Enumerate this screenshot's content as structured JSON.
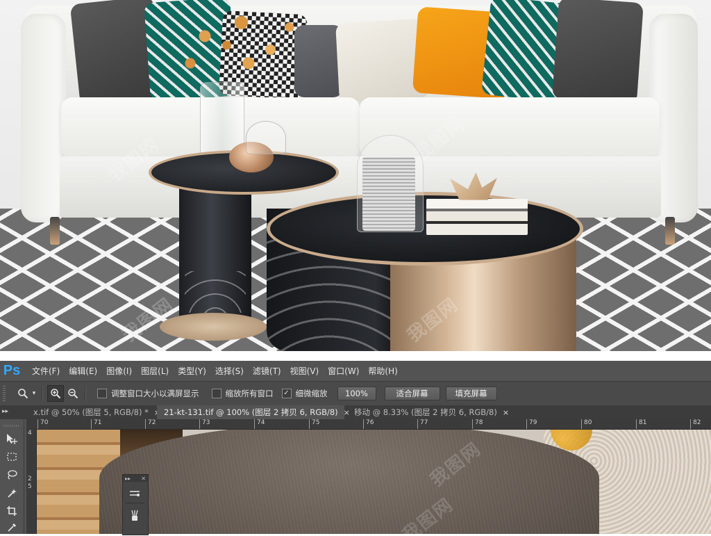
{
  "photo": {
    "watermark": "我图网"
  },
  "app": {
    "logo": "Ps"
  },
  "menu": [
    "文件(F)",
    "编辑(E)",
    "图像(I)",
    "图层(L)",
    "类型(Y)",
    "选择(S)",
    "滤镜(T)",
    "视图(V)",
    "窗口(W)",
    "帮助(H)"
  ],
  "options": {
    "zoom_tool_icon": "zoom-icon",
    "checkbox_resize_label": "调整窗口大小以满屏显示",
    "checkbox_resize_checked": false,
    "checkbox_all_windows_label": "缩放所有窗口",
    "checkbox_all_windows_checked": false,
    "checkbox_scrubby_label": "细微缩放",
    "checkbox_scrubby_checked": true,
    "zoom_percent": "100%",
    "fit_screen_label": "适合屏幕",
    "fill_screen_label": "填充屏幕"
  },
  "tabs": [
    {
      "label": "x.tif @ 50% (图层 5, RGB/8) *",
      "active": false
    },
    {
      "label": "21-kt-131.tif @ 100% (图层 2 拷贝 6, RGB/8)",
      "active": true
    },
    {
      "label": "移动 @ 8.33% (图层 2 拷贝 6, RGB/8)",
      "active": false
    }
  ],
  "tab_close": "×",
  "ruler": {
    "h_labels": [
      "70",
      "71",
      "72",
      "73",
      "74",
      "75",
      "76",
      "77",
      "78",
      "79",
      "80",
      "81",
      "82"
    ],
    "v_labels": [
      "4",
      "2",
      "5"
    ]
  },
  "mini_panel": {
    "collapse": "▸▸",
    "close": "✕"
  }
}
